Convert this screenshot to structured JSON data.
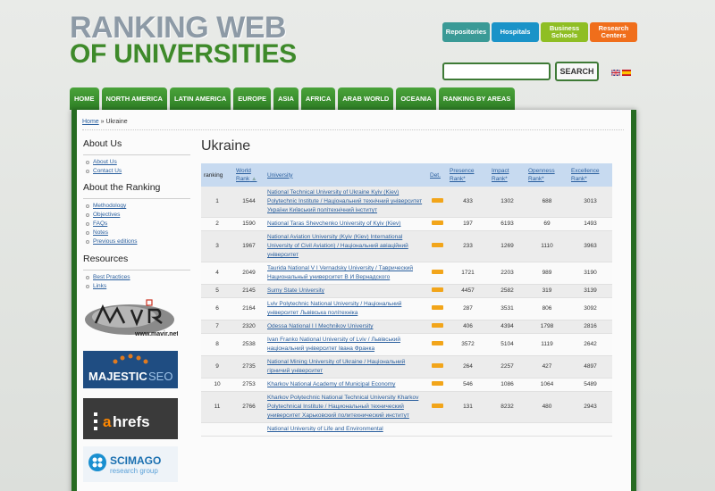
{
  "logo": {
    "line1": "RANKING WEB",
    "line2": "OF UNIVERSITIES"
  },
  "quick_links": [
    {
      "label": "Repositories",
      "color": "#3a9a96"
    },
    {
      "label": "Hospitals",
      "color": "#1a93c8"
    },
    {
      "label": "Business Schools",
      "color": "#8fbe24"
    },
    {
      "label": "Research Centers",
      "color": "#f06e1b"
    }
  ],
  "search": {
    "button_label": "SEARCH",
    "value": ""
  },
  "languages": [
    "english-flag-icon",
    "spanish-flag-icon"
  ],
  "nav": [
    "HOME",
    "NORTH AMERICA",
    "LATIN AMERICA",
    "EUROPE",
    "ASIA",
    "AFRICA",
    "ARAB WORLD",
    "OCEANIA",
    "RANKING BY AREAS"
  ],
  "breadcrumb": {
    "home": "Home",
    "separator": " » ",
    "current": "Ukraine"
  },
  "sidebar": {
    "about_us": {
      "title": "About Us",
      "items": [
        "About Us",
        "Contact Us"
      ]
    },
    "about_ranking": {
      "title": "About the Ranking",
      "items": [
        "Methodology",
        "Objectives",
        "FAQs",
        "Notes",
        "Previous editions"
      ]
    },
    "resources": {
      "title": "Resources",
      "items": [
        "Best Practices",
        "Links"
      ]
    }
  },
  "sponsors": [
    "www.mavir.net",
    "MAJESTICSEO",
    "ahrefs",
    "SCIMAGO research group"
  ],
  "page_title": "Ukraine",
  "table": {
    "headers": {
      "ranking": "ranking",
      "world_rank": "World Rank",
      "university": "University",
      "det": "Det.",
      "presence": "Presence Rank*",
      "impact": "Impact Rank*",
      "openness": "Openness Rank*",
      "excellence": "Excellence Rank*"
    },
    "rows": [
      {
        "ranking": "1",
        "world": "1544",
        "name": "National Technical University of Ukraine Kyiv (Kiev) Polytechnic Institute / Національний технічний університет України Київський політехнічний інститут",
        "presence": "433",
        "impact": "1302",
        "openness": "688",
        "excellence": "3013"
      },
      {
        "ranking": "2",
        "world": "1590",
        "name": "National Taras Shevchenko University of Kyiv (Kiev)",
        "presence": "197",
        "impact": "6193",
        "openness": "69",
        "excellence": "1493"
      },
      {
        "ranking": "3",
        "world": "1967",
        "name": "National Aviation University (Kyiv (Kiev) International University of Civil Aviation) / Національний авіаційний університет",
        "presence": "233",
        "impact": "1269",
        "openness": "1110",
        "excellence": "3963"
      },
      {
        "ranking": "4",
        "world": "2049",
        "name": "Taurida National V I Vernadsky University / Таврический Национальный университет В И Вернадского",
        "presence": "1721",
        "impact": "2203",
        "openness": "989",
        "excellence": "3190"
      },
      {
        "ranking": "5",
        "world": "2145",
        "name": "Sumy State University",
        "presence": "4457",
        "impact": "2582",
        "openness": "319",
        "excellence": "3139"
      },
      {
        "ranking": "6",
        "world": "2164",
        "name": "Lviv Polytechnic National University / Національний університет Львівська політехніка",
        "presence": "287",
        "impact": "3531",
        "openness": "806",
        "excellence": "3092"
      },
      {
        "ranking": "7",
        "world": "2320",
        "name": "Odessa National I I Mechnikov University",
        "presence": "406",
        "impact": "4394",
        "openness": "1798",
        "excellence": "2816"
      },
      {
        "ranking": "8",
        "world": "2538",
        "name": "Ivan Franko National University of Lviv / Львівський національний університет Івана Франка",
        "presence": "3572",
        "impact": "5104",
        "openness": "1119",
        "excellence": "2642"
      },
      {
        "ranking": "9",
        "world": "2735",
        "name": "National Mining University of Ukraine / Національний гірничий університет",
        "presence": "264",
        "impact": "2257",
        "openness": "427",
        "excellence": "4897"
      },
      {
        "ranking": "10",
        "world": "2753",
        "name": "Kharkov National Academy of Municipal Economy",
        "presence": "546",
        "impact": "1086",
        "openness": "1064",
        "excellence": "5489"
      },
      {
        "ranking": "11",
        "world": "2766",
        "name": "Kharkov Polytechnic National Technical University Kharkov Polytechnical Institute / Национальный технический университет Харьковский политехнический институт",
        "presence": "131",
        "impact": "8232",
        "openness": "480",
        "excellence": "2943"
      },
      {
        "ranking": "",
        "world": "",
        "name": "National University of Life and Environmental",
        "presence": "",
        "impact": "",
        "openness": "",
        "excellence": ""
      }
    ]
  }
}
